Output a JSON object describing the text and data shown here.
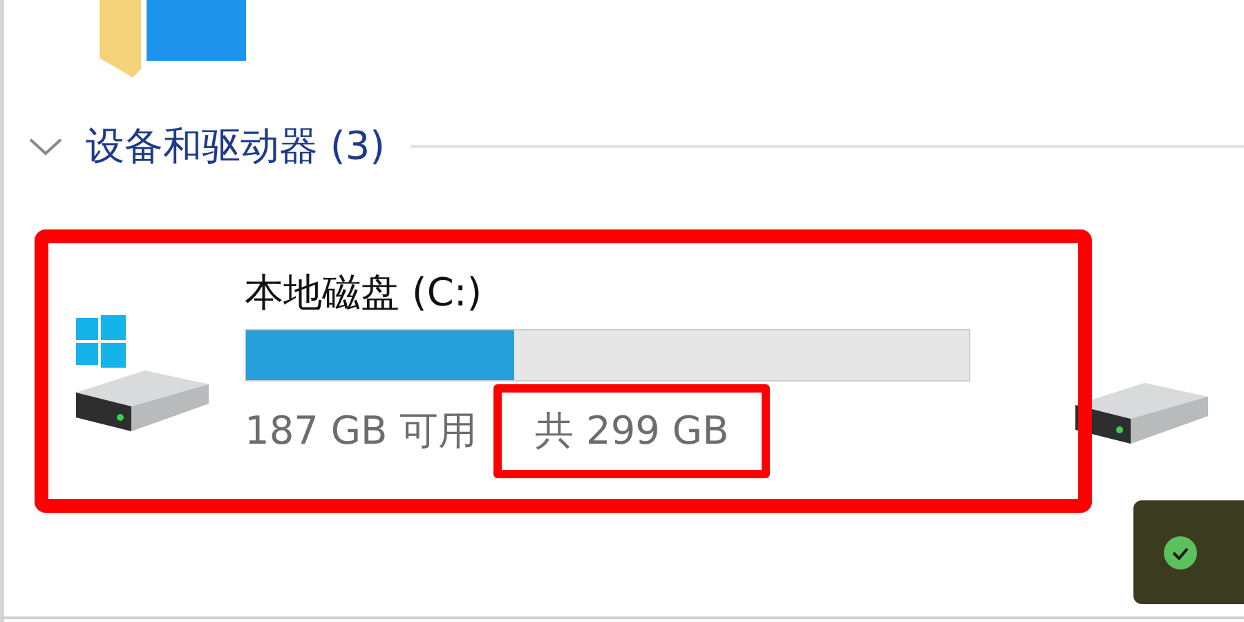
{
  "group": {
    "title": "设备和驱动器 (3)",
    "expanded": true
  },
  "drives": [
    {
      "name": "本地磁盘 (C:)",
      "level": 0.37,
      "free": "187 GB 可用",
      "total": "共 299 GB",
      "kind": "system"
    },
    {
      "kind": "plain"
    }
  ]
}
